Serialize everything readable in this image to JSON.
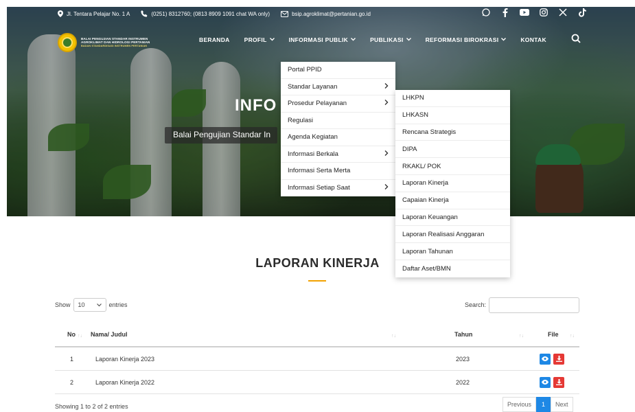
{
  "topbar": {
    "address": "Jl. Tentara Pelajar No. 1 A",
    "phone": "(0251) 8312760; (0813 8909 1091 chat WA only)",
    "email": "bsip.agroklimat@pertanian.go.id",
    "social_icons": [
      "whatsapp-icon",
      "facebook-icon",
      "youtube-icon",
      "instagram-icon",
      "x-icon",
      "tiktok-icon"
    ]
  },
  "logo": {
    "line1": "BALAI PENGUJIAN STANDAR INSTRUMEN",
    "line2": "AGROKLIMAT DAN HIDROLOGI PERTANIAN",
    "line3": "BADAN STANDARDISASI INSTRUMEN PERTANIAN"
  },
  "nav": {
    "items": [
      {
        "label": "BERANDA",
        "dropdown": false
      },
      {
        "label": "PROFIL",
        "dropdown": true
      },
      {
        "label": "INFORMASI PUBLIK",
        "dropdown": true
      },
      {
        "label": "PUBLIKASI",
        "dropdown": true
      },
      {
        "label": "REFORMASI BIROKRASI",
        "dropdown": true
      },
      {
        "label": "KONTAK",
        "dropdown": false
      }
    ]
  },
  "hero": {
    "title": "INFO",
    "subtitle": "Balai Pengujian Standar In"
  },
  "dropdown1": {
    "items": [
      {
        "label": "Portal PPID",
        "sub": false
      },
      {
        "label": "Standar Layanan",
        "sub": true
      },
      {
        "label": "Prosedur Pelayanan",
        "sub": true
      },
      {
        "label": "Regulasi",
        "sub": false
      },
      {
        "label": "Agenda Kegiatan",
        "sub": false
      },
      {
        "label": "Informasi Berkala",
        "sub": true
      },
      {
        "label": "Informasi Serta Merta",
        "sub": false
      },
      {
        "label": "Informasi Setiap Saat",
        "sub": true
      }
    ]
  },
  "dropdown2": {
    "items": [
      "LHKPN",
      "LHKASN",
      "Rencana Strategis",
      "DIPA",
      "RKAKL/ POK",
      "Laporan Kinerja",
      "Capaian Kinerja",
      "Laporan Keuangan",
      "Laporan Realisasi Anggaran",
      "Laporan Tahunan",
      "Daftar Aset/BMN"
    ]
  },
  "section": {
    "title": "LAPORAN KINERJA"
  },
  "table_controls": {
    "show_label": "Show",
    "entries_value": "10",
    "entries_label": "entries",
    "search_label": "Search:"
  },
  "table": {
    "headers": {
      "no": "No",
      "title": "Nama/ Judul",
      "year": "Tahun",
      "file": "File"
    },
    "rows": [
      {
        "no": "1",
        "title": "Laporan Kinerja 2023",
        "year": "2023"
      },
      {
        "no": "2",
        "title": "Laporan Kinerja 2022",
        "year": "2022"
      }
    ]
  },
  "footer": {
    "info": "Showing 1 to 2 of 2 entries",
    "prev": "Previous",
    "page": "1",
    "next": "Next"
  },
  "colors": {
    "accent": "#f2a100",
    "view_button": "#1e88e5",
    "download_button": "#e53935"
  }
}
